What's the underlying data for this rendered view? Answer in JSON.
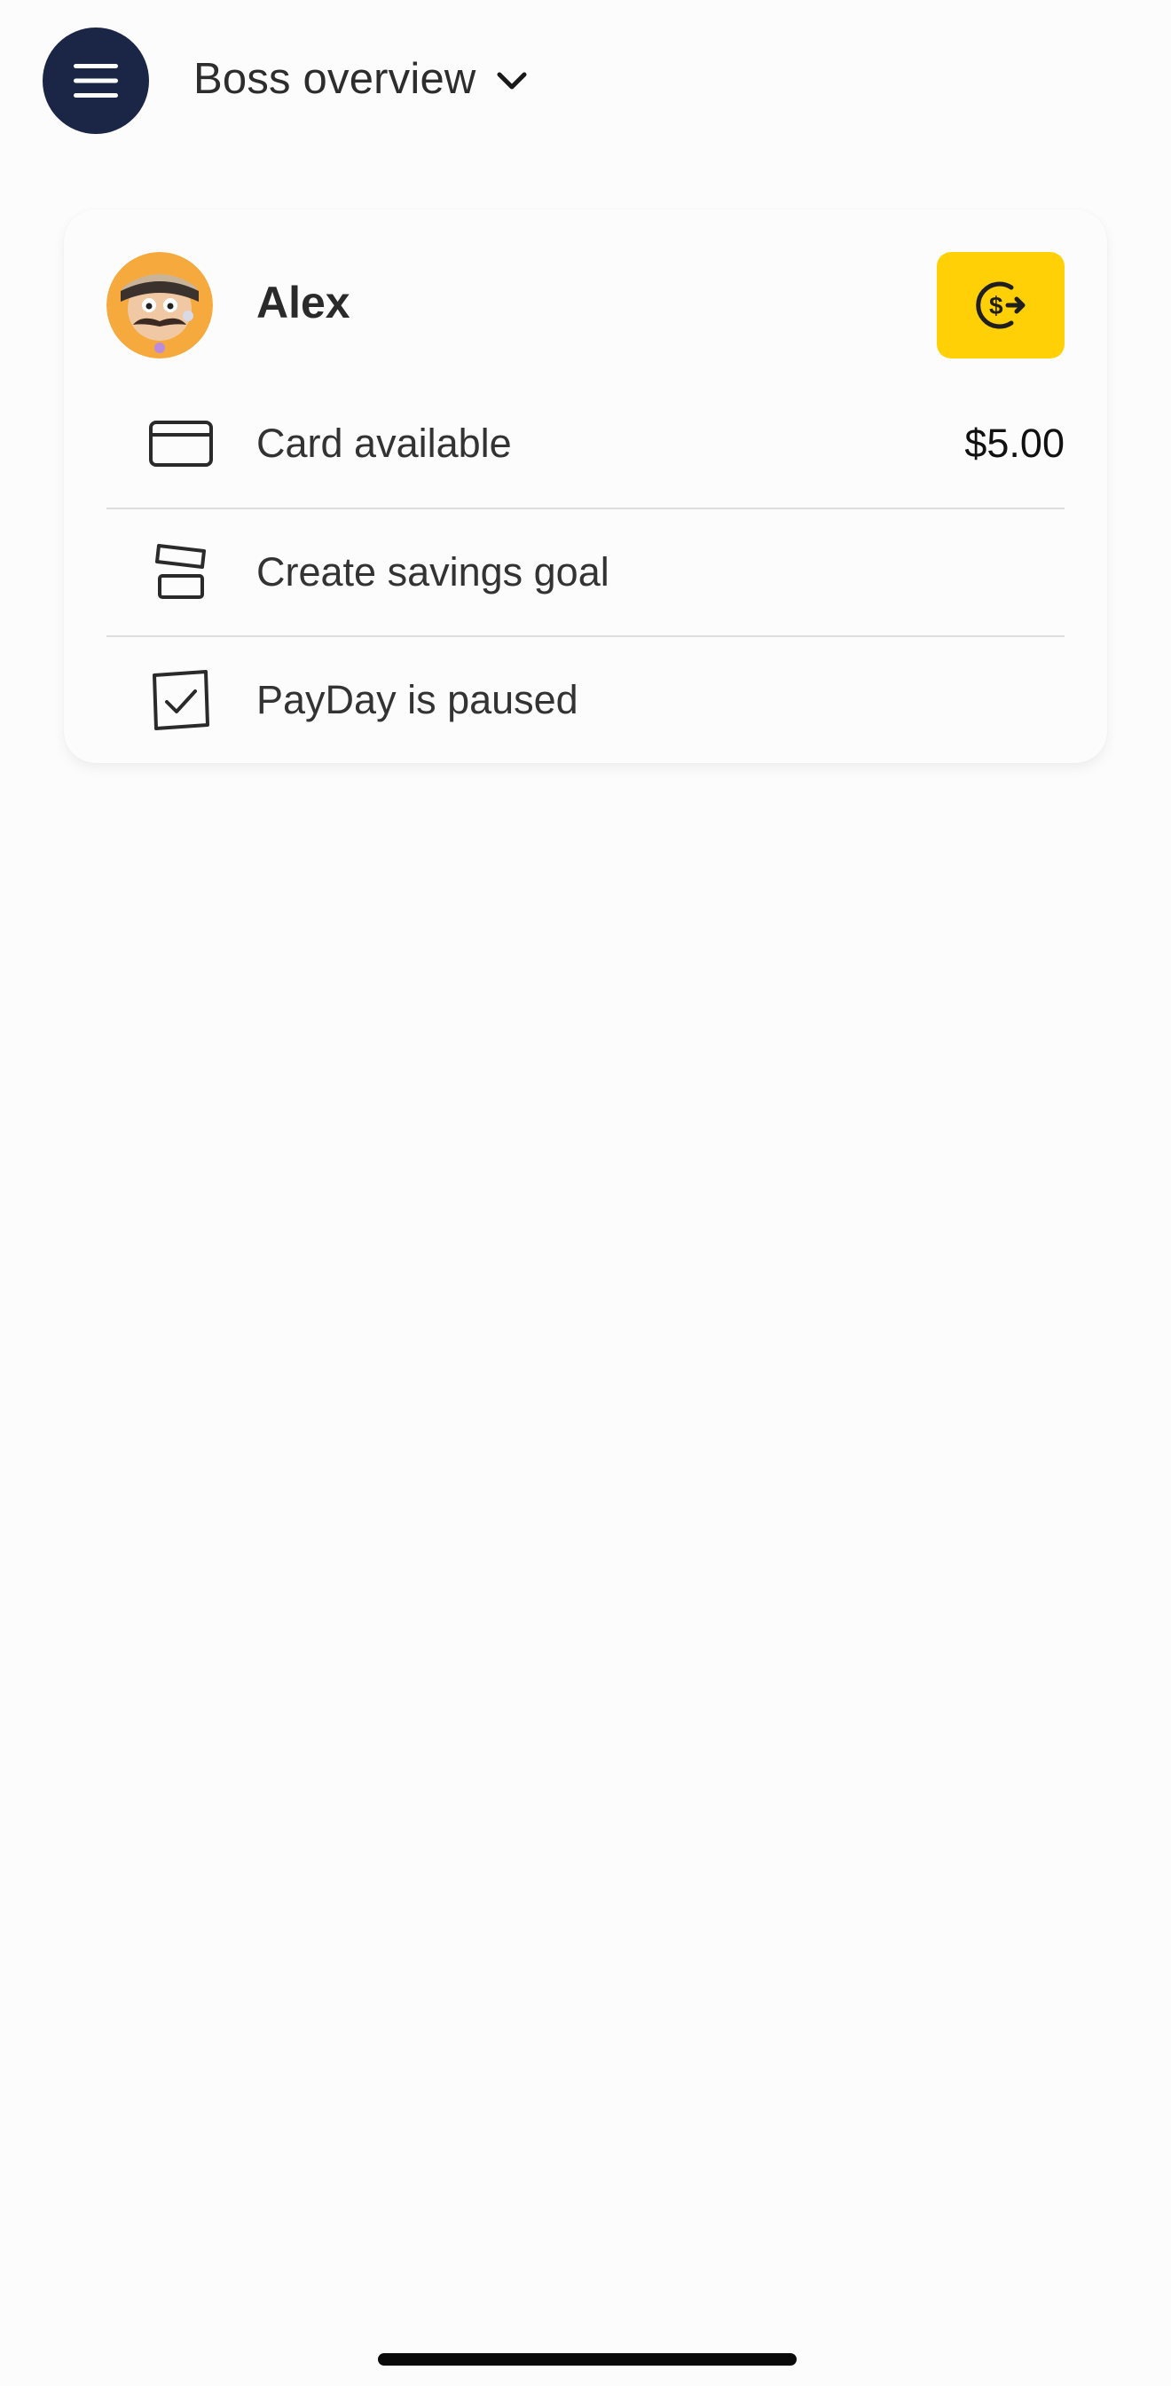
{
  "header": {
    "menu_icon": "hamburger-menu-icon",
    "view_title": "Boss overview",
    "dropdown_icon": "chevron-down-icon"
  },
  "kid_card": {
    "name": "Alex",
    "avatar": "cartoon-avatar-mustache-beanie",
    "action_icon": "money-transfer-icon",
    "accent_color": "#ffd005",
    "rows": [
      {
        "icon": "credit-card-icon",
        "label": "Card available",
        "value": "$5.00"
      },
      {
        "icon": "savings-stack-icon",
        "label": "Create savings goal",
        "value": ""
      },
      {
        "icon": "checkbox-icon",
        "label": "PayDay is paused",
        "value": ""
      }
    ]
  },
  "colors": {
    "menu_button_bg": "#1b2647",
    "background": "#fdfcfc"
  }
}
